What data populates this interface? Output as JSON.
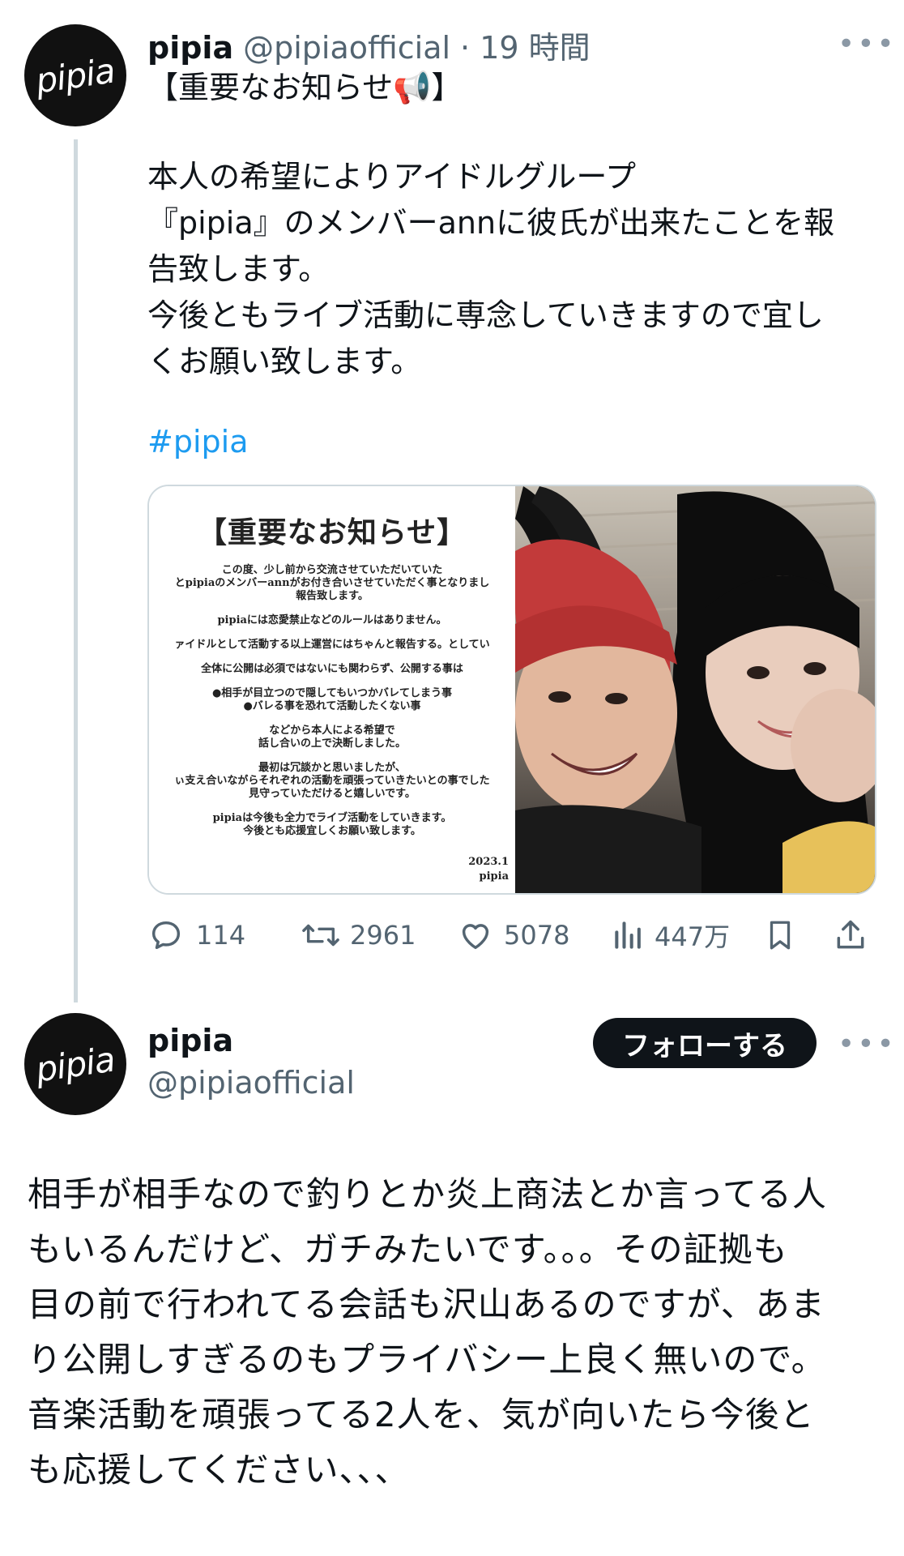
{
  "tweet": {
    "avatar_text": "pipia",
    "name": "pipia",
    "handle": "@pipiaofficial",
    "time": "· 19 時間",
    "more": "•••",
    "header_line": "【重要なお知らせ📢】",
    "body": "本人の希望によりアイドルグループ\n『pipia』のメンバーannに彼氏が出来たことを報\n告致します。\n今後ともライブ活動に専念していきますので宜し\nくお願い致します。",
    "hashtag": "#pipia",
    "notice": {
      "title": "【重要なお知らせ】",
      "lines": [
        "この度、少し前から交流させていただいていた",
        "とpipiaのメンバーannがお付き合いさせていただく事となりまし",
        "報告致します。",
        "pipiaには恋愛禁止などのルールはありません。",
        "ァイドルとして活動する以上運営にはちゃんと報告する。としてい",
        "全体に公開は必須ではないにも関わらず、公開する事は",
        "●相手が目立つので隠してもいつかバレてしまう事",
        "●バレる事を恐れて活動したくない事",
        "などから本人による希望で",
        "話し合いの上で決断しました。",
        "最初は冗談かと思いましたが、",
        "ぃ支え合いながらそれぞれの活動を頑張っていきたいとの事でした",
        "見守っていただけると嬉しいです。",
        "pipiaは今後も全力でライブ活動をしていきます。",
        "今後とも応援宜しくお願い致します。"
      ],
      "date": "2023.1",
      "sign": "pipia"
    },
    "stats": {
      "replies": "114",
      "retweets": "2961",
      "likes": "5078",
      "views": "447万"
    }
  },
  "reply": {
    "avatar_text": "pipia",
    "name": "pipia",
    "handle": "@pipiaofficial",
    "follow_label": "フォローする",
    "more": "•••",
    "body": "相手が相手なので釣りとか炎上商法とか言ってる人\nもいるんだけど、ガチみたいです。。。その証拠も\n目の前で行われてる会話も沢山あるのですが、あま\nり公開しすぎるのもプライバシー上良く無いので。\n音楽活動を頑張ってる2人を、気が向いたら今後と\nも応援してください、、、"
  },
  "colors": {
    "link": "#1d9bf0",
    "muted": "#536471",
    "thread_line": "#cfd9de",
    "follow_bg": "#0f1419"
  }
}
